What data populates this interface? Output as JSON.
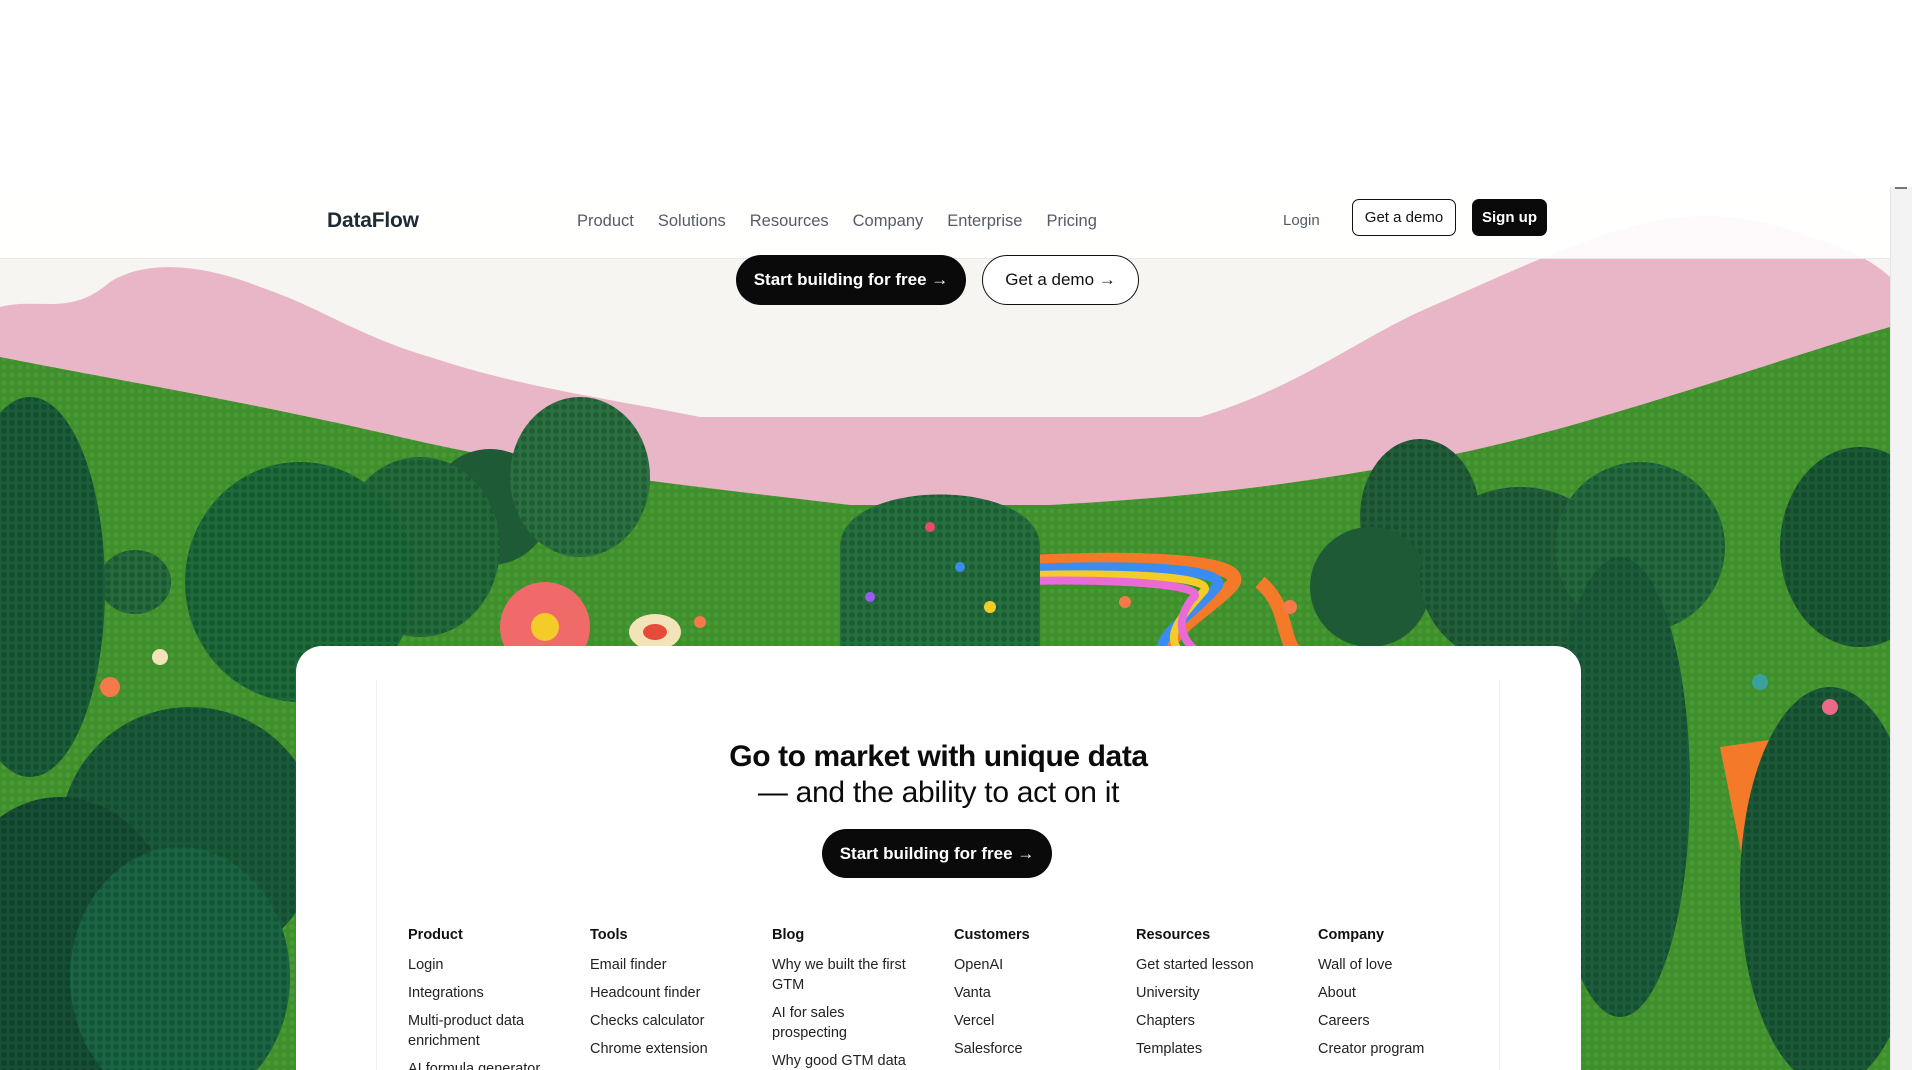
{
  "header": {
    "logo": "DataFlow",
    "nav": [
      "Product",
      "Solutions",
      "Resources",
      "Company",
      "Enterprise",
      "Pricing"
    ],
    "login": "Login",
    "demo": "Get a demo",
    "signup": "Sign up"
  },
  "hero": {
    "primary_cta": "Start building for free →",
    "secondary_cta": "Get a demo →"
  },
  "card": {
    "title": "Go to market with unique data",
    "subtitle": "— and the ability to act on it",
    "cta": "Start building for free →"
  },
  "footer": {
    "columns": [
      {
        "title": "Product",
        "links": [
          "Login",
          "Integrations",
          "Multi-product data enrichment",
          "AI formula generator"
        ]
      },
      {
        "title": "Tools",
        "links": [
          "Email finder",
          "Headcount finder",
          "Checks calculator",
          "Chrome extension"
        ]
      },
      {
        "title": "Blog",
        "links": [
          "Why we built the first GTM",
          "AI for sales prospecting",
          "Why good GTM data"
        ]
      },
      {
        "title": "Customers",
        "links": [
          "OpenAI",
          "Vanta",
          "Vercel",
          "Salesforce"
        ]
      },
      {
        "title": "Resources",
        "links": [
          "Get started lesson",
          "University",
          "Chapters",
          "Templates"
        ]
      },
      {
        "title": "Company",
        "links": [
          "Wall of love",
          "About",
          "Careers",
          "Creator program"
        ]
      }
    ]
  },
  "colors": {
    "grass": "#3f8f2a",
    "hill_pink": "#e8b6c6",
    "bush_dark": "#1f5a36",
    "button_dark": "#0a0a0a"
  }
}
